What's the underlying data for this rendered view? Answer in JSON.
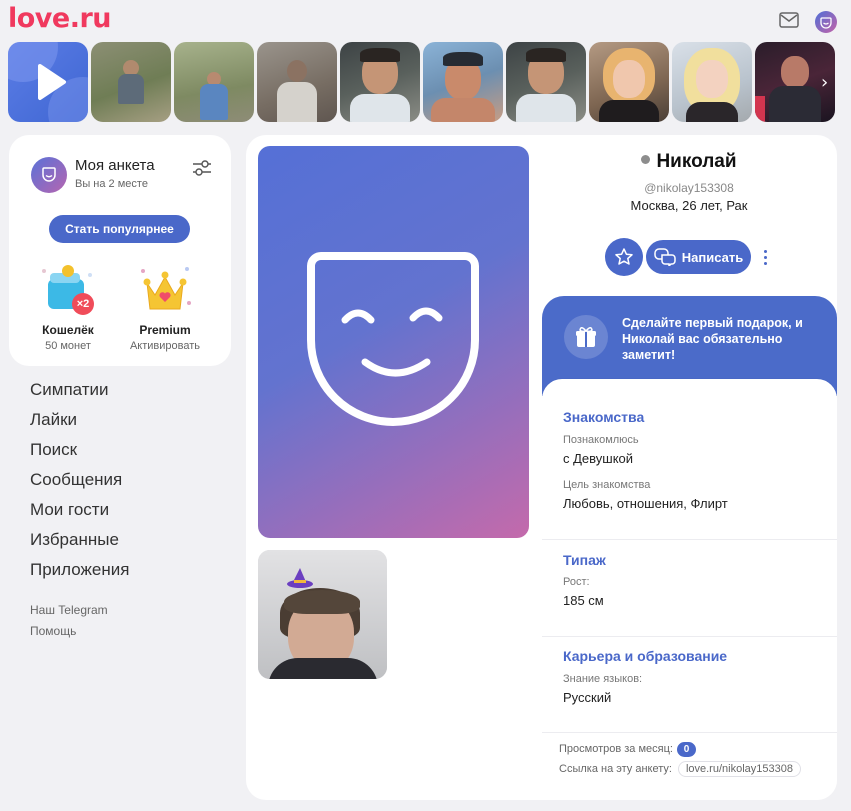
{
  "app": {
    "logo": "love.ru"
  },
  "colors": {
    "brand": "#f0395e",
    "accent": "#4a68c9"
  },
  "header": {
    "mail_icon": "envelope-icon",
    "avatar_icon": "mask-avatar-icon"
  },
  "stories": {
    "count": 10,
    "first": "play-icon",
    "arrow": "›"
  },
  "my_profile": {
    "title": "Моя анкета",
    "subtitle": "Вы на 2 месте",
    "settings_icon": "sliders-icon",
    "popular_button": "Стать популярнее",
    "wallet": {
      "name": "Кошелёк",
      "sub": "50 монет",
      "multiplier": "×2"
    },
    "premium": {
      "name": "Premium",
      "sub": "Активировать"
    }
  },
  "menu": [
    "Симпатии",
    "Лайки",
    "Поиск",
    "Сообщения",
    "Мои гости",
    "Избранные",
    "Приложения"
  ],
  "small_links": [
    "Наш Telegram",
    "Помощь"
  ],
  "profile": {
    "name": "Николай",
    "username": "@nikolay153308",
    "location": "Москва, 26 лет, Рак",
    "write_button": "Написать",
    "status": "offline"
  },
  "gift": {
    "text": "Сделайте первый подарок, и Николай вас обязательно заметит!"
  },
  "sections": {
    "dating": {
      "title": "Знакомства",
      "label1": "Познакомлюсь",
      "value1": "с Девушкой",
      "label2": "Цель знакомства",
      "value2": "Любовь, отношения, Флирт"
    },
    "type": {
      "title": "Типаж",
      "label1": "Рост:",
      "value1": "185 см"
    },
    "career": {
      "title": "Карьера и образование",
      "label1": "Знание языков:",
      "value1": "Русский"
    }
  },
  "stats": {
    "views_label": "Просмотров за месяц:",
    "views_value": "0",
    "link_label": "Ссылка на эту анкету:",
    "link_value": "love.ru/nikolay153308"
  }
}
